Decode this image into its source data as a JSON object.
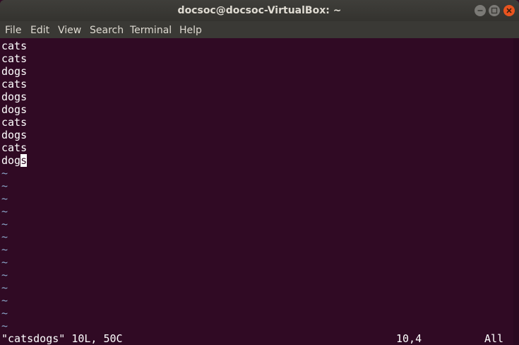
{
  "window": {
    "title": "docsoc@docsoc-VirtualBox: ~"
  },
  "menu": {
    "items": [
      "File",
      "Edit",
      "View",
      "Search",
      "Terminal",
      "Help"
    ]
  },
  "buffer": {
    "lines": [
      "cats",
      "cats",
      "dogs",
      "cats",
      "dogs",
      "dogs",
      "cats",
      "dogs",
      "cats",
      "dog"
    ],
    "cursor_line_prefix": "dog",
    "cursor_char": "s",
    "empty_line_marker": "~"
  },
  "status": {
    "file_info": "\"catsdogs\" 10L, 50C",
    "position": "10,4",
    "scroll": "All"
  },
  "colors": {
    "background": "#300a24",
    "text": "#ffffff",
    "tilde": "#8aa6c9",
    "close_button": "#e9541f"
  }
}
